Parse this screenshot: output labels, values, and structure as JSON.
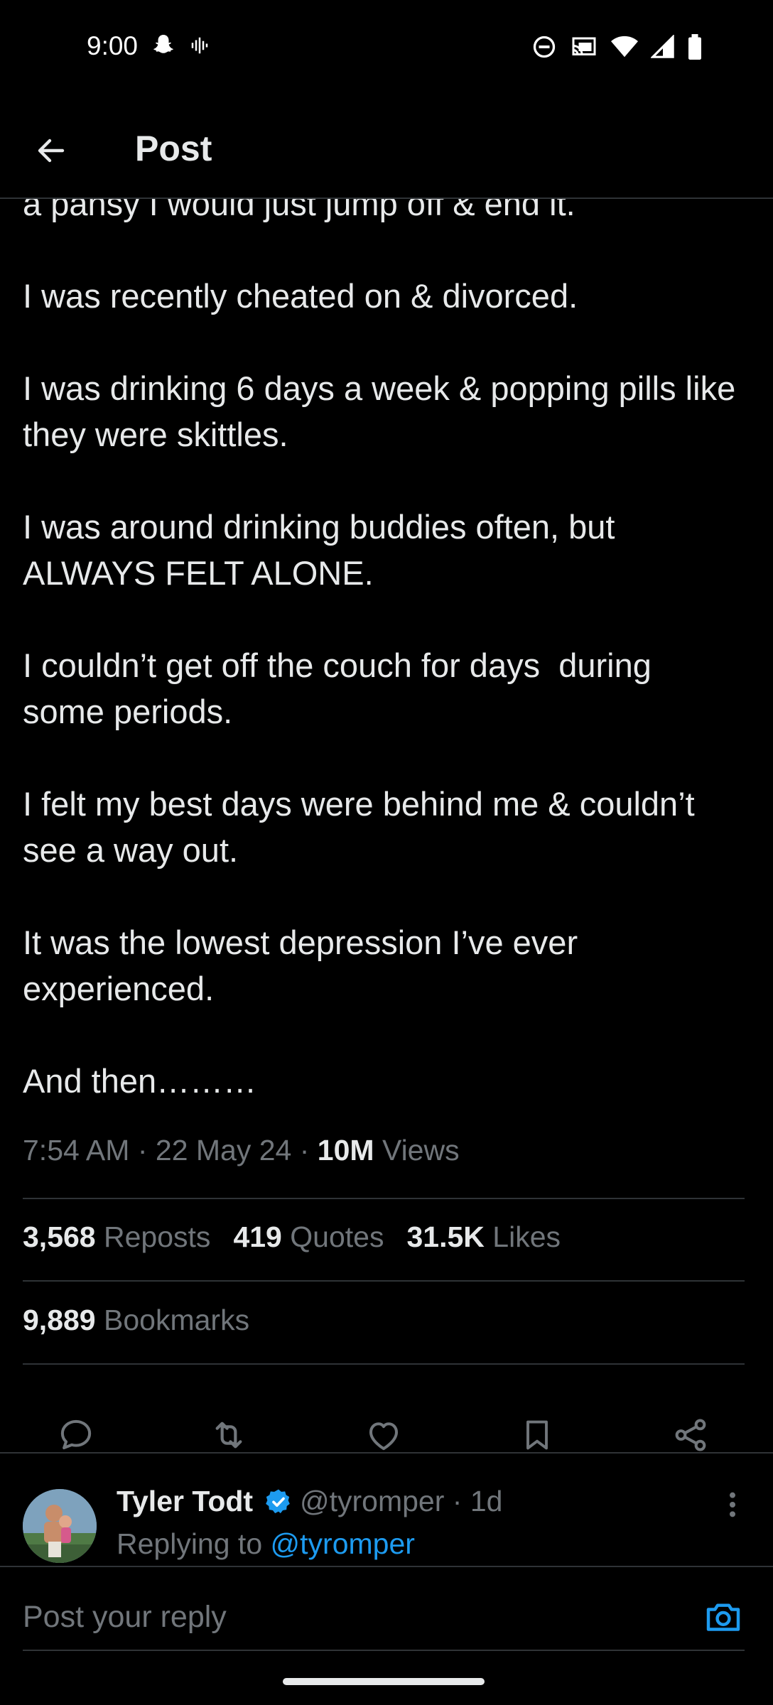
{
  "status": {
    "time": "9:00"
  },
  "header": {
    "title": "Post"
  },
  "post": {
    "paragraphs": [
      "a pansy I would just jump off & end it.",
      "I was recently cheated on & divorced.",
      "I was drinking 6 days a week & popping pills like they were skittles.",
      "I was around drinking buddies often, but ALWAYS FELT ALONE.",
      "I couldn’t get off the couch for days  during some periods.",
      "I felt my best days were behind me & couldn’t see a way out.",
      "It was the lowest depression I’ve ever experienced.",
      "And then………"
    ],
    "time": "7:54 AM",
    "date": "22 May 24",
    "views_count": "10M",
    "views_label": "Views"
  },
  "stats": {
    "reposts_count": "3,568",
    "reposts_label": "Reposts",
    "quotes_count": "419",
    "quotes_label": "Quotes",
    "likes_count": "31.5K",
    "likes_label": "Likes",
    "bookmarks_count": "9,889",
    "bookmarks_label": "Bookmarks"
  },
  "actions": [
    "reply-icon",
    "repost-icon",
    "like-icon",
    "bookmark-icon",
    "share-icon"
  ],
  "reply": {
    "name": "Tyler Todt",
    "handle": "@tyromper",
    "age": "1d",
    "replying_prefix": "Replying to",
    "replying_to": "@tyromper"
  },
  "composer": {
    "placeholder": "Post your reply"
  },
  "colors": {
    "accent": "#1d9bf0",
    "background": "#000000",
    "text": "#e7e9ea",
    "muted": "#71767b",
    "border": "#2f3336"
  }
}
